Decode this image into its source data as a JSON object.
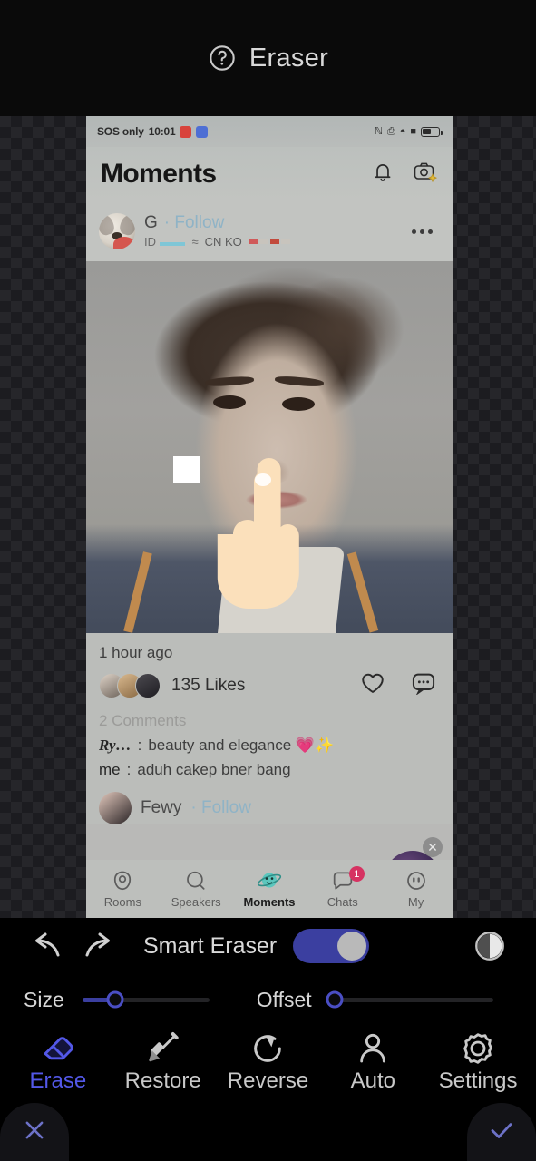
{
  "titlebar": {
    "help_icon": "help-circle-icon",
    "title": "Eraser"
  },
  "phone": {
    "status_bar": {
      "carrier": "SOS only",
      "time": "10:01",
      "app_badges": [
        "red-app-icon",
        "blue-app-icon"
      ],
      "right_icons": [
        "nfc-icon",
        "vibrate-icon",
        "wifi-icon",
        "signal-icon",
        "battery-icon"
      ]
    },
    "app_header": {
      "title": "Moments",
      "icons": [
        "bell-icon",
        "camera-add-icon"
      ]
    },
    "post": {
      "author": "G",
      "follow_label": "· Follow",
      "id_label": "ID",
      "approx": "≈",
      "country": "CN KO",
      "more_icon": "more-options-icon",
      "timestamp": "1 hour ago",
      "likes": "135 Likes",
      "like_icon": "heart-icon",
      "comment_icon": "comment-bubble-icon",
      "comments_count": "2 Comments",
      "comments": [
        {
          "user": "Ry…",
          "sep": ":",
          "text": "beauty and elegance 💗✨"
        },
        {
          "user": "me",
          "sep": ":",
          "text": "aduh cakep bner bang"
        }
      ]
    },
    "next_post": {
      "author": "Fewy",
      "follow_label": "· Follow"
    },
    "music_bubble": {
      "icon": "equalizer-icon",
      "close_icon": "close-icon"
    },
    "nav": [
      {
        "label": "Rooms",
        "icon": "rooms-icon",
        "active": false,
        "badge": ""
      },
      {
        "label": "Speakers",
        "icon": "search-icon",
        "active": false,
        "badge": ""
      },
      {
        "label": "Moments",
        "icon": "planet-icon",
        "active": true,
        "badge": ""
      },
      {
        "label": "Chats",
        "icon": "chat-icon",
        "active": false,
        "badge": "1"
      },
      {
        "label": "My",
        "icon": "profile-icon",
        "active": false,
        "badge": ""
      }
    ]
  },
  "editor": {
    "undo_icon": "undo-icon",
    "redo_icon": "redo-icon",
    "smart_eraser_label": "Smart Eraser",
    "smart_eraser_on": true,
    "contrast_icon": "contrast-icon",
    "size_label": "Size",
    "offset_label": "Offset",
    "tools": [
      {
        "label": "Erase",
        "icon": "eraser-icon",
        "active": true
      },
      {
        "label": "Restore",
        "icon": "brush-icon",
        "active": false
      },
      {
        "label": "Reverse",
        "icon": "reverse-icon",
        "active": false
      },
      {
        "label": "Auto",
        "icon": "person-icon",
        "active": false
      },
      {
        "label": "Settings",
        "icon": "gear-icon",
        "active": false
      }
    ],
    "cancel_icon": "close-icon",
    "confirm_icon": "check-icon"
  },
  "colors": {
    "accent": "#3b3fa0",
    "tool_active": "#5358e8",
    "badge": "#d63362",
    "follow_link": "#8fb3c6",
    "background": "#000000"
  }
}
